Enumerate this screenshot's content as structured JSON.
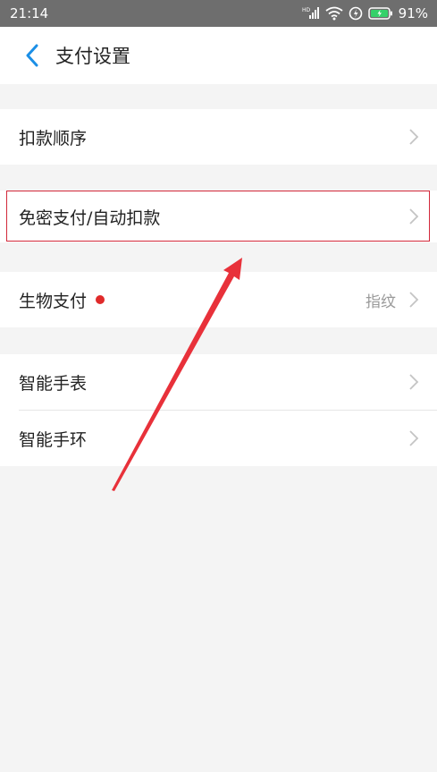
{
  "status_bar": {
    "time": "21:14",
    "network_badge": "HD",
    "battery_percent": "91%",
    "icons": [
      "signal-icon",
      "wifi-icon",
      "data-saver-icon",
      "battery-charging-icon"
    ]
  },
  "header": {
    "title": "支付设置",
    "back_icon": "chevron-left-icon",
    "accent_color": "#1b8fe6"
  },
  "sections": [
    {
      "items": [
        {
          "label": "扣款顺序"
        }
      ]
    },
    {
      "items": [
        {
          "label": "免密支付/自动扣款",
          "highlighted": true
        }
      ]
    },
    {
      "items": [
        {
          "label": "生物支付",
          "badge": "red-dot",
          "value": "指纹"
        }
      ]
    },
    {
      "items": [
        {
          "label": "智能手表"
        },
        {
          "label": "智能手环"
        }
      ]
    }
  ],
  "annotation": {
    "highlight_color": "#d2283a",
    "arrow_color": "#e8313a"
  }
}
